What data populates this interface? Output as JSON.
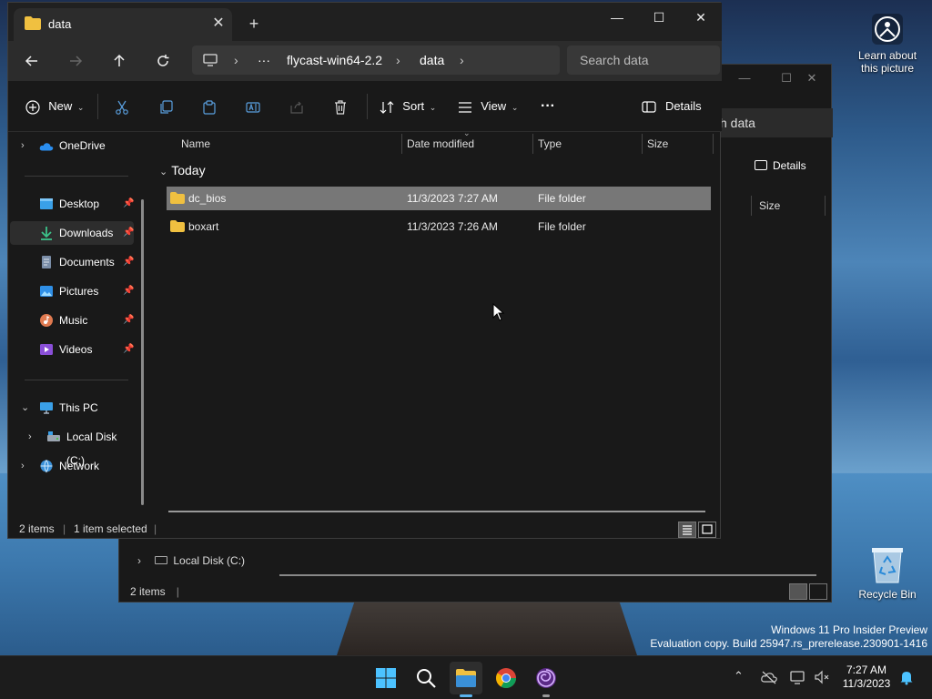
{
  "desktop": {
    "learn_label": "Learn about\nthis picture",
    "recycle_label": "Recycle Bin",
    "watermark_line1": "Windows 11 Pro Insider Preview",
    "watermark_line2": "Evaluation copy. Build 25947.rs_prerelease.230901-1416"
  },
  "bg_window": {
    "search_partial": "h data",
    "details_label": "Details",
    "size_header": "Size",
    "local_disk": "Local Disk (C:)",
    "status_items": "2 items"
  },
  "window": {
    "tab_title": "data",
    "new_tab": "+",
    "controls": {
      "minimize": "—",
      "maximize": "☐",
      "close": "✕"
    },
    "breadcrumb": {
      "ellipsis": "···",
      "segments": [
        "flycast-win64-2.2",
        "data"
      ]
    },
    "search": {
      "placeholder": "Search data"
    },
    "toolbar": {
      "new_label": "New",
      "sort_label": "Sort",
      "view_label": "View",
      "more_label": "···",
      "details_label": "Details"
    },
    "sidebar": {
      "onedrive": "OneDrive",
      "desktop": "Desktop",
      "downloads": "Downloads",
      "documents": "Documents",
      "pictures": "Pictures",
      "music": "Music",
      "videos": "Videos",
      "this_pc": "This PC",
      "local_disk": "Local Disk (C:)",
      "network": "Network"
    },
    "columns": {
      "name": "Name",
      "date": "Date modified",
      "type": "Type",
      "size": "Size"
    },
    "group_label": "Today",
    "files": [
      {
        "name": "dc_bios",
        "date": "11/3/2023 7:27 AM",
        "type": "File folder"
      },
      {
        "name": "boxart",
        "date": "11/3/2023 7:26 AM",
        "type": "File folder"
      }
    ],
    "status": {
      "items": "2 items",
      "selected": "1 item selected"
    }
  },
  "taskbar": {
    "time": "7:27 AM",
    "date": "11/3/2023"
  },
  "colors": {
    "accent": "#4cc2ff",
    "folder": "#f0c040",
    "selection": "#777777"
  }
}
